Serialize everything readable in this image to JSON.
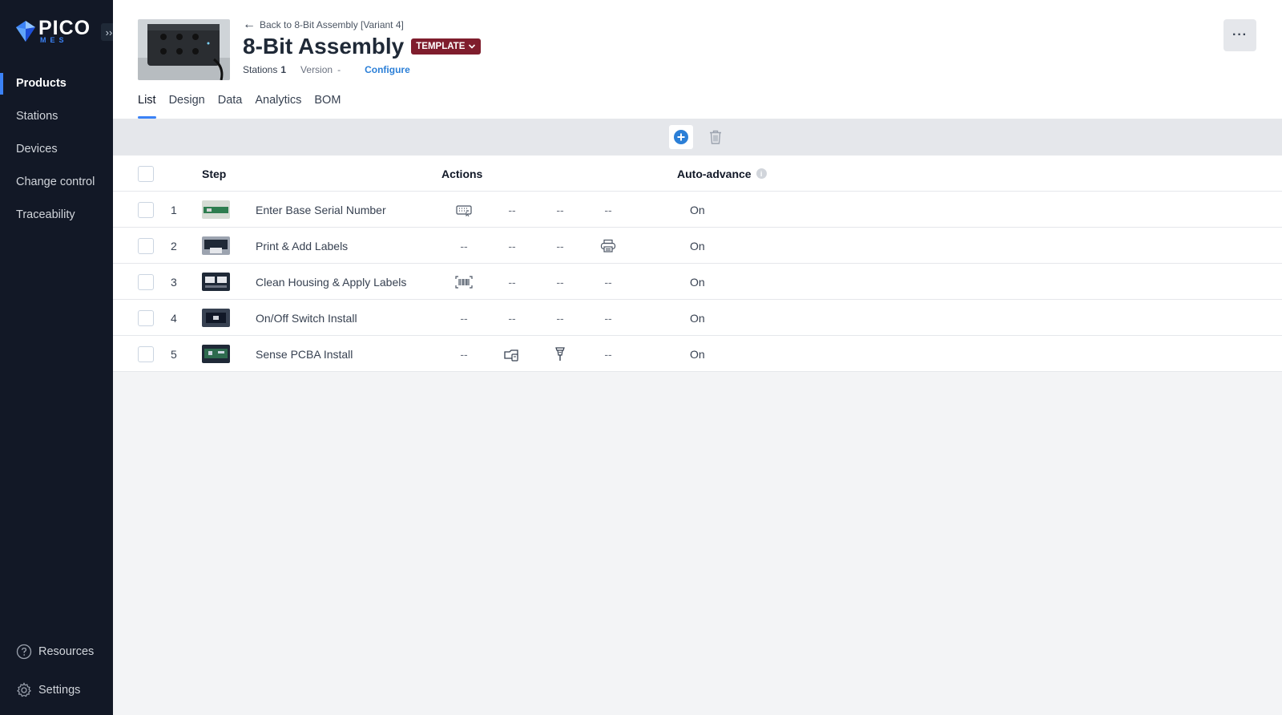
{
  "brand": {
    "name": "PICO",
    "sub": "MES"
  },
  "sidebar": {
    "items": [
      {
        "label": "Products"
      },
      {
        "label": "Stations"
      },
      {
        "label": "Devices"
      },
      {
        "label": "Change control"
      },
      {
        "label": "Traceability"
      }
    ],
    "bottom": [
      {
        "label": "Resources",
        "icon": "help-circle-icon"
      },
      {
        "label": "Settings",
        "icon": "gear-icon"
      }
    ]
  },
  "header": {
    "back_label": "Back to 8-Bit Assembly [Variant 4]",
    "title": "8-Bit Assembly",
    "badge": "TEMPLATE",
    "stations_label": "Stations",
    "stations_value": "1",
    "version_label": "Version",
    "version_value": "-",
    "configure_label": "Configure",
    "more_label": "···"
  },
  "tabs": [
    "List",
    "Design",
    "Data",
    "Analytics",
    "BOM"
  ],
  "table": {
    "headers": {
      "step": "Step",
      "actions": "Actions",
      "auto": "Auto-advance",
      "info": "i"
    },
    "empty": "--",
    "rows": [
      {
        "num": "1",
        "name": "Enter Base Serial Number",
        "actions": [
          "keyboard-icon",
          "--",
          "--",
          "--"
        ],
        "auto": "On"
      },
      {
        "num": "2",
        "name": "Print & Add Labels",
        "actions": [
          "--",
          "--",
          "--",
          "printer-icon"
        ],
        "auto": "On"
      },
      {
        "num": "3",
        "name": "Clean Housing & Apply Labels",
        "actions": [
          "barcode-icon",
          "--",
          "--",
          "--"
        ],
        "auto": "On"
      },
      {
        "num": "4",
        "name": "On/Off Switch Install",
        "actions": [
          "--",
          "--",
          "--",
          "--"
        ],
        "auto": "On"
      },
      {
        "num": "5",
        "name": "Sense PCBA Install",
        "actions": [
          "--",
          "tool-case-icon",
          "screwdriver-icon",
          "--"
        ],
        "auto": "On"
      }
    ]
  },
  "colors": {
    "sidebar": "#121826",
    "accent": "#3b82f6",
    "badge": "#7f1d2d",
    "link": "#2b7fd7"
  }
}
